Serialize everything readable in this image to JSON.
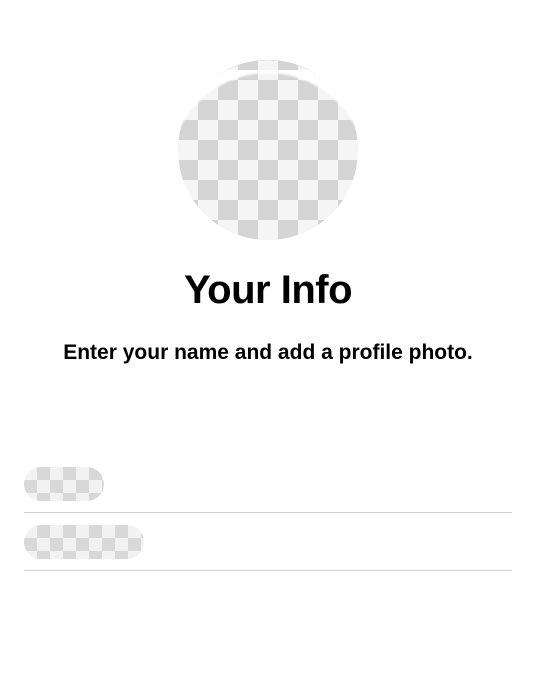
{
  "header": {
    "title": "Your Info",
    "subtitle": "Enter your name and add a profile photo."
  },
  "avatar": {
    "state": "placeholder"
  },
  "fields": {
    "first": {
      "value": "",
      "placeholder": ""
    },
    "second": {
      "value": "",
      "placeholder": ""
    }
  }
}
